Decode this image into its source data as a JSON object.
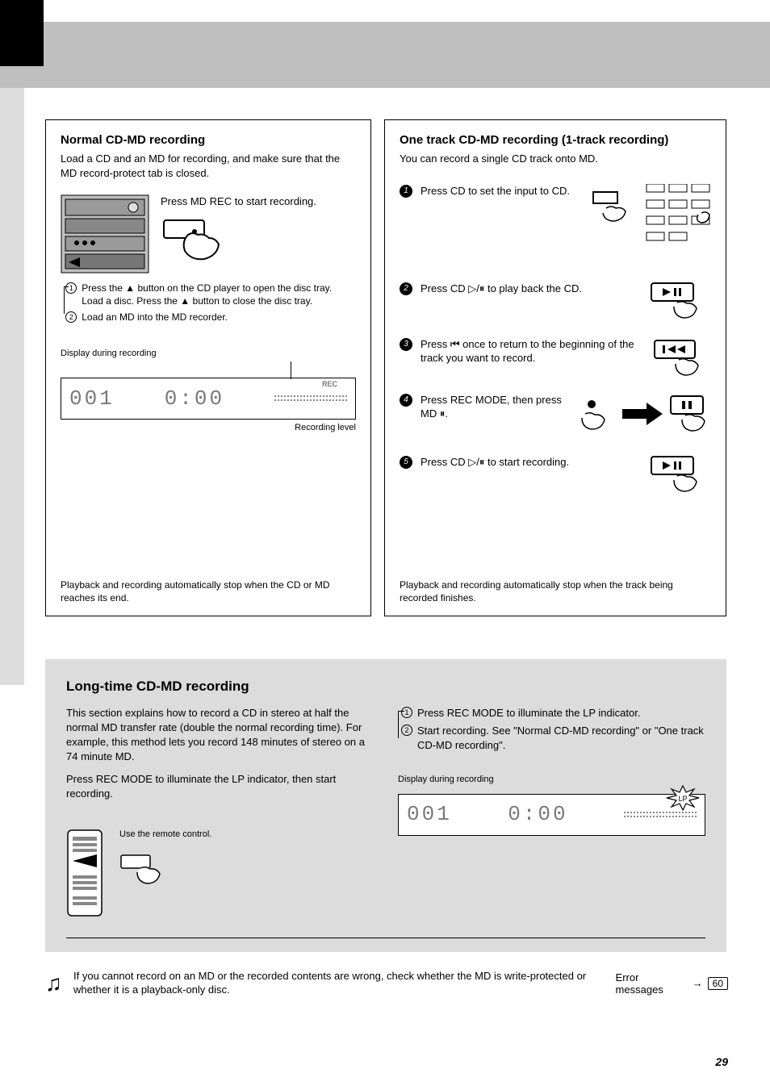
{
  "left_panel": {
    "title": "Normal CD-MD recording",
    "intro": "Load a CD and an MD for recording, and make sure that the MD record-protect tab is closed.",
    "step_text": "Press MD REC to start recording.",
    "sub1": "Press the ▲ button on the CD player to open the disc tray. Load a disc. Press the ▲ button to close the disc tray.",
    "sub2": "Load an MD into the MD recorder.",
    "display_caption": "Display during recording",
    "track": "001",
    "time": "0:00",
    "rec_label": "REC",
    "pointer_label": "Recording level",
    "footnote": "Playback and recording automatically stop when the CD or MD reaches its end."
  },
  "right_panel": {
    "title": "One track CD-MD recording (1-track recording)",
    "intro": "You can record a single CD track onto MD.",
    "step1": "Press CD to set the input to CD.",
    "step2": "Press CD ▷/⏸ to play back the CD.",
    "step3": "Press ⏮ once to return to the beginning of the track you want to record.",
    "step4": "Press REC MODE, then press MD ⏸.",
    "step5": "Press CD ▷/⏸ to start recording.",
    "footnote": "Playback and recording automatically stop when the track being recorded finishes."
  },
  "bottom": {
    "title": "Long-time CD-MD recording",
    "col1_p1": "This section explains how to record a CD in stereo at half the normal MD transfer rate (double the normal recording time). For example, this method lets you record 148 minutes of stereo on a 74 minute MD.",
    "col1_p2": "Press REC MODE to illuminate the LP indicator, then start recording.",
    "use_remote": "Use the remote control.",
    "col2_sub1": "Press REC MODE to illuminate the LP indicator.",
    "col2_sub2": "Start recording. See \"Normal CD-MD recording\" or \"One track CD-MD recording\".",
    "display_caption": "Display during recording",
    "track": "001",
    "time": "0:00",
    "lp_flag": "LP"
  },
  "footer": {
    "text": "If you cannot record on an MD or the recorded contents are wrong, check whether the MD is write-protected or whether it is a playback-only disc.",
    "ref_text": "Error messages",
    "ref_page": "60"
  },
  "page_number": "29"
}
